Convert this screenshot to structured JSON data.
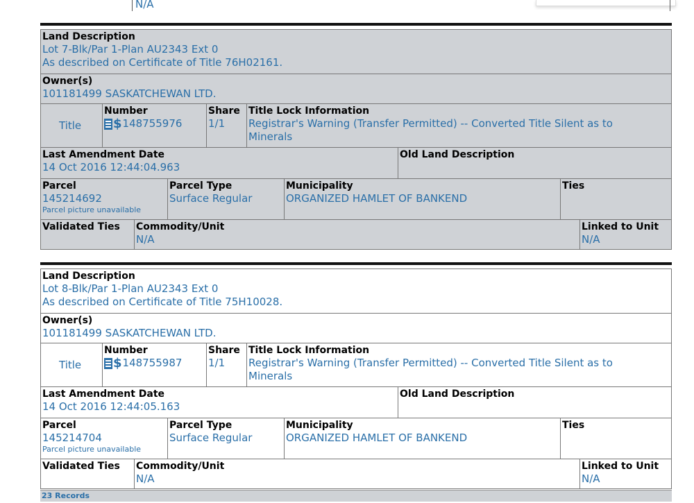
{
  "top_fragment": {
    "value": "N/A"
  },
  "labels": {
    "land_description": "Land Description",
    "owners": "Owner(s)",
    "number": "Number",
    "share": "Share",
    "title_lock": "Title Lock Information",
    "last_amendment": "Last Amendment Date",
    "old_land": "Old Land Description",
    "parcel": "Parcel",
    "parcel_type": "Parcel Type",
    "municipality": "Municipality",
    "ties": "Ties",
    "validated_ties": "Validated Ties",
    "commodity": "Commodity/Unit",
    "linked": "Linked to Unit",
    "title_word": "Title"
  },
  "records": [
    {
      "land_line1": "Lot 7-Blk/Par 1-Plan AU2343 Ext 0",
      "land_line2": "As described on Certificate of Title 76H02161.",
      "owner": "101181499 SASKATCHEWAN LTD.",
      "title_number": "148755976",
      "share": "1/1",
      "title_lock_line1": "Registrar's Warning (Transfer Permitted) -- Converted Title Silent as to",
      "title_lock_line2": "Minerals",
      "last_amendment": "14 Oct 2016 12:44:04.963",
      "parcel": "145214692",
      "parcel_note": "Parcel picture unavailable",
      "parcel_type": "Surface Regular",
      "municipality": "ORGANIZED HAMLET OF BANKEND",
      "commodity": "N/A",
      "linked": "N/A"
    },
    {
      "land_line1": "Lot 8-Blk/Par 1-Plan AU2343 Ext 0",
      "land_line2": "As described on Certificate of Title 75H10028.",
      "owner": "101181499 SASKATCHEWAN LTD.",
      "title_number": "148755987",
      "share": "1/1",
      "title_lock_line1": "Registrar's Warning (Transfer Permitted) -- Converted Title Silent as to",
      "title_lock_line2": "Minerals",
      "last_amendment": "14 Oct 2016 12:44:05.163",
      "parcel": "145214704",
      "parcel_note": "Parcel picture unavailable",
      "parcel_type": "Surface Regular",
      "municipality": "ORGANIZED HAMLET OF BANKEND",
      "commodity": "N/A",
      "linked": "N/A"
    }
  ],
  "footer": {
    "records_count": "23 Records"
  },
  "colors": {
    "link": "#2a6fa8",
    "gray_row": "#cfd2d6"
  },
  "icons": [
    "document-icon",
    "dollar-icon"
  ]
}
